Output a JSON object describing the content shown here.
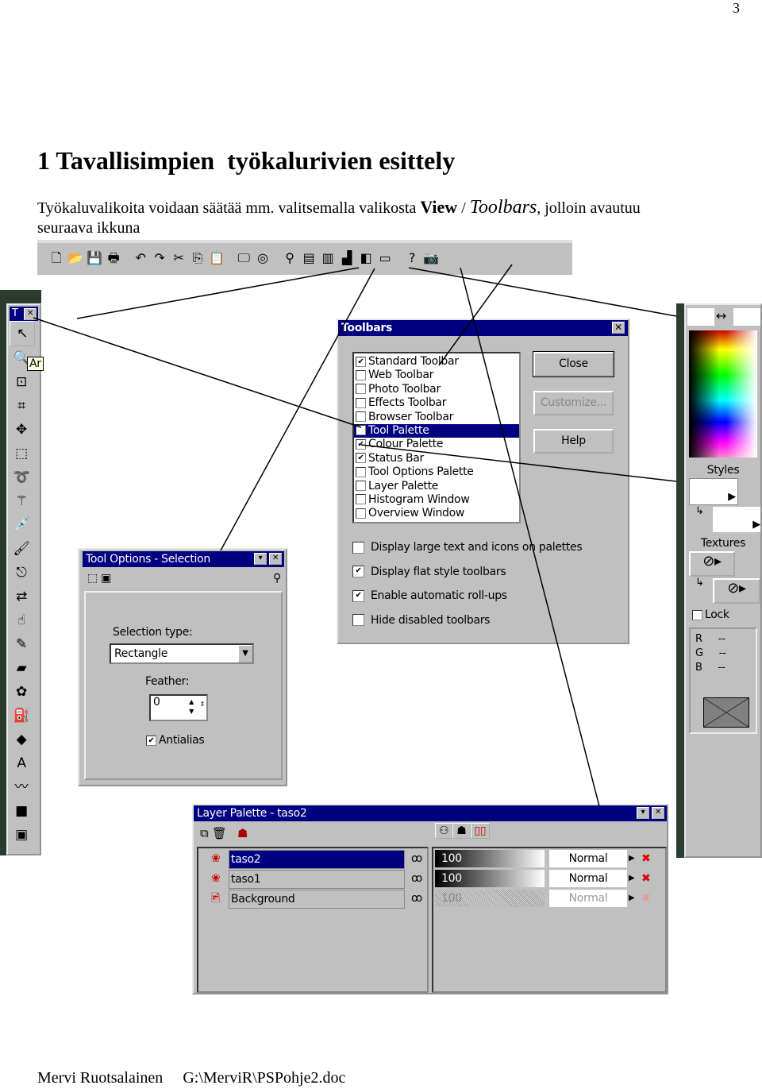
{
  "page_number": "3",
  "heading": "1 Tavallisimpien  työkalurivien esittely",
  "intro": {
    "before": "Työkaluvalikoita voidaan säätää mm. valitsemalla valikosta ",
    "menu": "View",
    "sep": " / ",
    "submenu": "Toolbars",
    "after": ", jolloin avautuu",
    "line2": "seuraava ikkuna"
  },
  "standard_toolbar": {
    "icons": [
      "new-icon",
      "open-icon",
      "save-icon",
      "print-icon",
      "undo-icon",
      "redo-icon",
      "cut-icon",
      "copy-icon",
      "paste-icon",
      "full-screen-icon",
      "browse-icon",
      "toolbars-icon",
      "tool-options-icon",
      "color-palette-icon",
      "histogram-icon",
      "layers-icon",
      "overview-icon",
      "help-icon",
      "twain-icon"
    ]
  },
  "tool_palette": {
    "title": "T",
    "tooltip": "Ar",
    "tools": [
      "arrow-icon",
      "zoom-icon",
      "deform-icon",
      "crop-icon",
      "mover-icon",
      "selection-icon",
      "freehand-icon",
      "magic-wand-icon",
      "dropper-icon",
      "paintbrush-icon",
      "clone-icon",
      "color-replacer-icon",
      "retouch-icon",
      "scratch-remover-icon",
      "eraser-icon",
      "picture-tube-icon",
      "airbrush-icon",
      "flood-fill-icon",
      "text-icon",
      "draw-icon",
      "preset-shapes-icon",
      "object-selector-icon"
    ]
  },
  "toolbars_dialog": {
    "title": "Toolbars",
    "items": [
      {
        "label": "Standard Toolbar",
        "checked": true
      },
      {
        "label": "Web Toolbar",
        "checked": false
      },
      {
        "label": "Photo Toolbar",
        "checked": false
      },
      {
        "label": "Effects Toolbar",
        "checked": false
      },
      {
        "label": "Browser Toolbar",
        "checked": false
      },
      {
        "label": "Tool Palette",
        "checked": true,
        "selected": true
      },
      {
        "label": "Colour Palette",
        "checked": true
      },
      {
        "label": "Status Bar",
        "checked": true
      },
      {
        "label": "Tool Options Palette",
        "checked": false
      },
      {
        "label": "Layer Palette",
        "checked": false
      },
      {
        "label": "Histogram Window",
        "checked": false
      },
      {
        "label": "Overview Window",
        "checked": false
      }
    ],
    "buttons": {
      "close": "Close",
      "customize": "Customize...",
      "help": "Help"
    },
    "options": [
      {
        "label": "Display large text and icons on palettes",
        "checked": false
      },
      {
        "label": "Display flat style toolbars",
        "checked": true
      },
      {
        "label": "Enable automatic roll-ups",
        "checked": true
      },
      {
        "label": "Hide disabled toolbars",
        "checked": false
      }
    ]
  },
  "tool_options": {
    "title": "Tool Options - Selection",
    "selection_type_label": "Selection type:",
    "selection_type": "Rectangle",
    "feather_label": "Feather:",
    "feather": "0",
    "antialias_label": "Antialias",
    "antialias": true
  },
  "colour_palette": {
    "styles_label": "Styles",
    "textures_label": "Textures",
    "lock_label": "Lock",
    "rgb": [
      {
        "k": "R",
        "v": "--"
      },
      {
        "k": "G",
        "v": "--"
      },
      {
        "k": "B",
        "v": "--"
      }
    ]
  },
  "layer_palette": {
    "title": "Layer Palette - taso2",
    "layers": [
      {
        "name": "taso2",
        "opacity": "100",
        "blend": "Normal",
        "selected": true,
        "enabled": true
      },
      {
        "name": "taso1",
        "opacity": "100",
        "blend": "Normal",
        "selected": false,
        "enabled": true
      },
      {
        "name": "Background",
        "opacity": "100",
        "blend": "Normal",
        "selected": false,
        "enabled": false
      }
    ]
  },
  "footer": {
    "author": "Mervi Ruotsalainen",
    "path": "G:\\MerviR\\PSPohje2.doc"
  },
  "colors": {
    "title_bar": "#000080",
    "window": "#c0c0c0"
  }
}
